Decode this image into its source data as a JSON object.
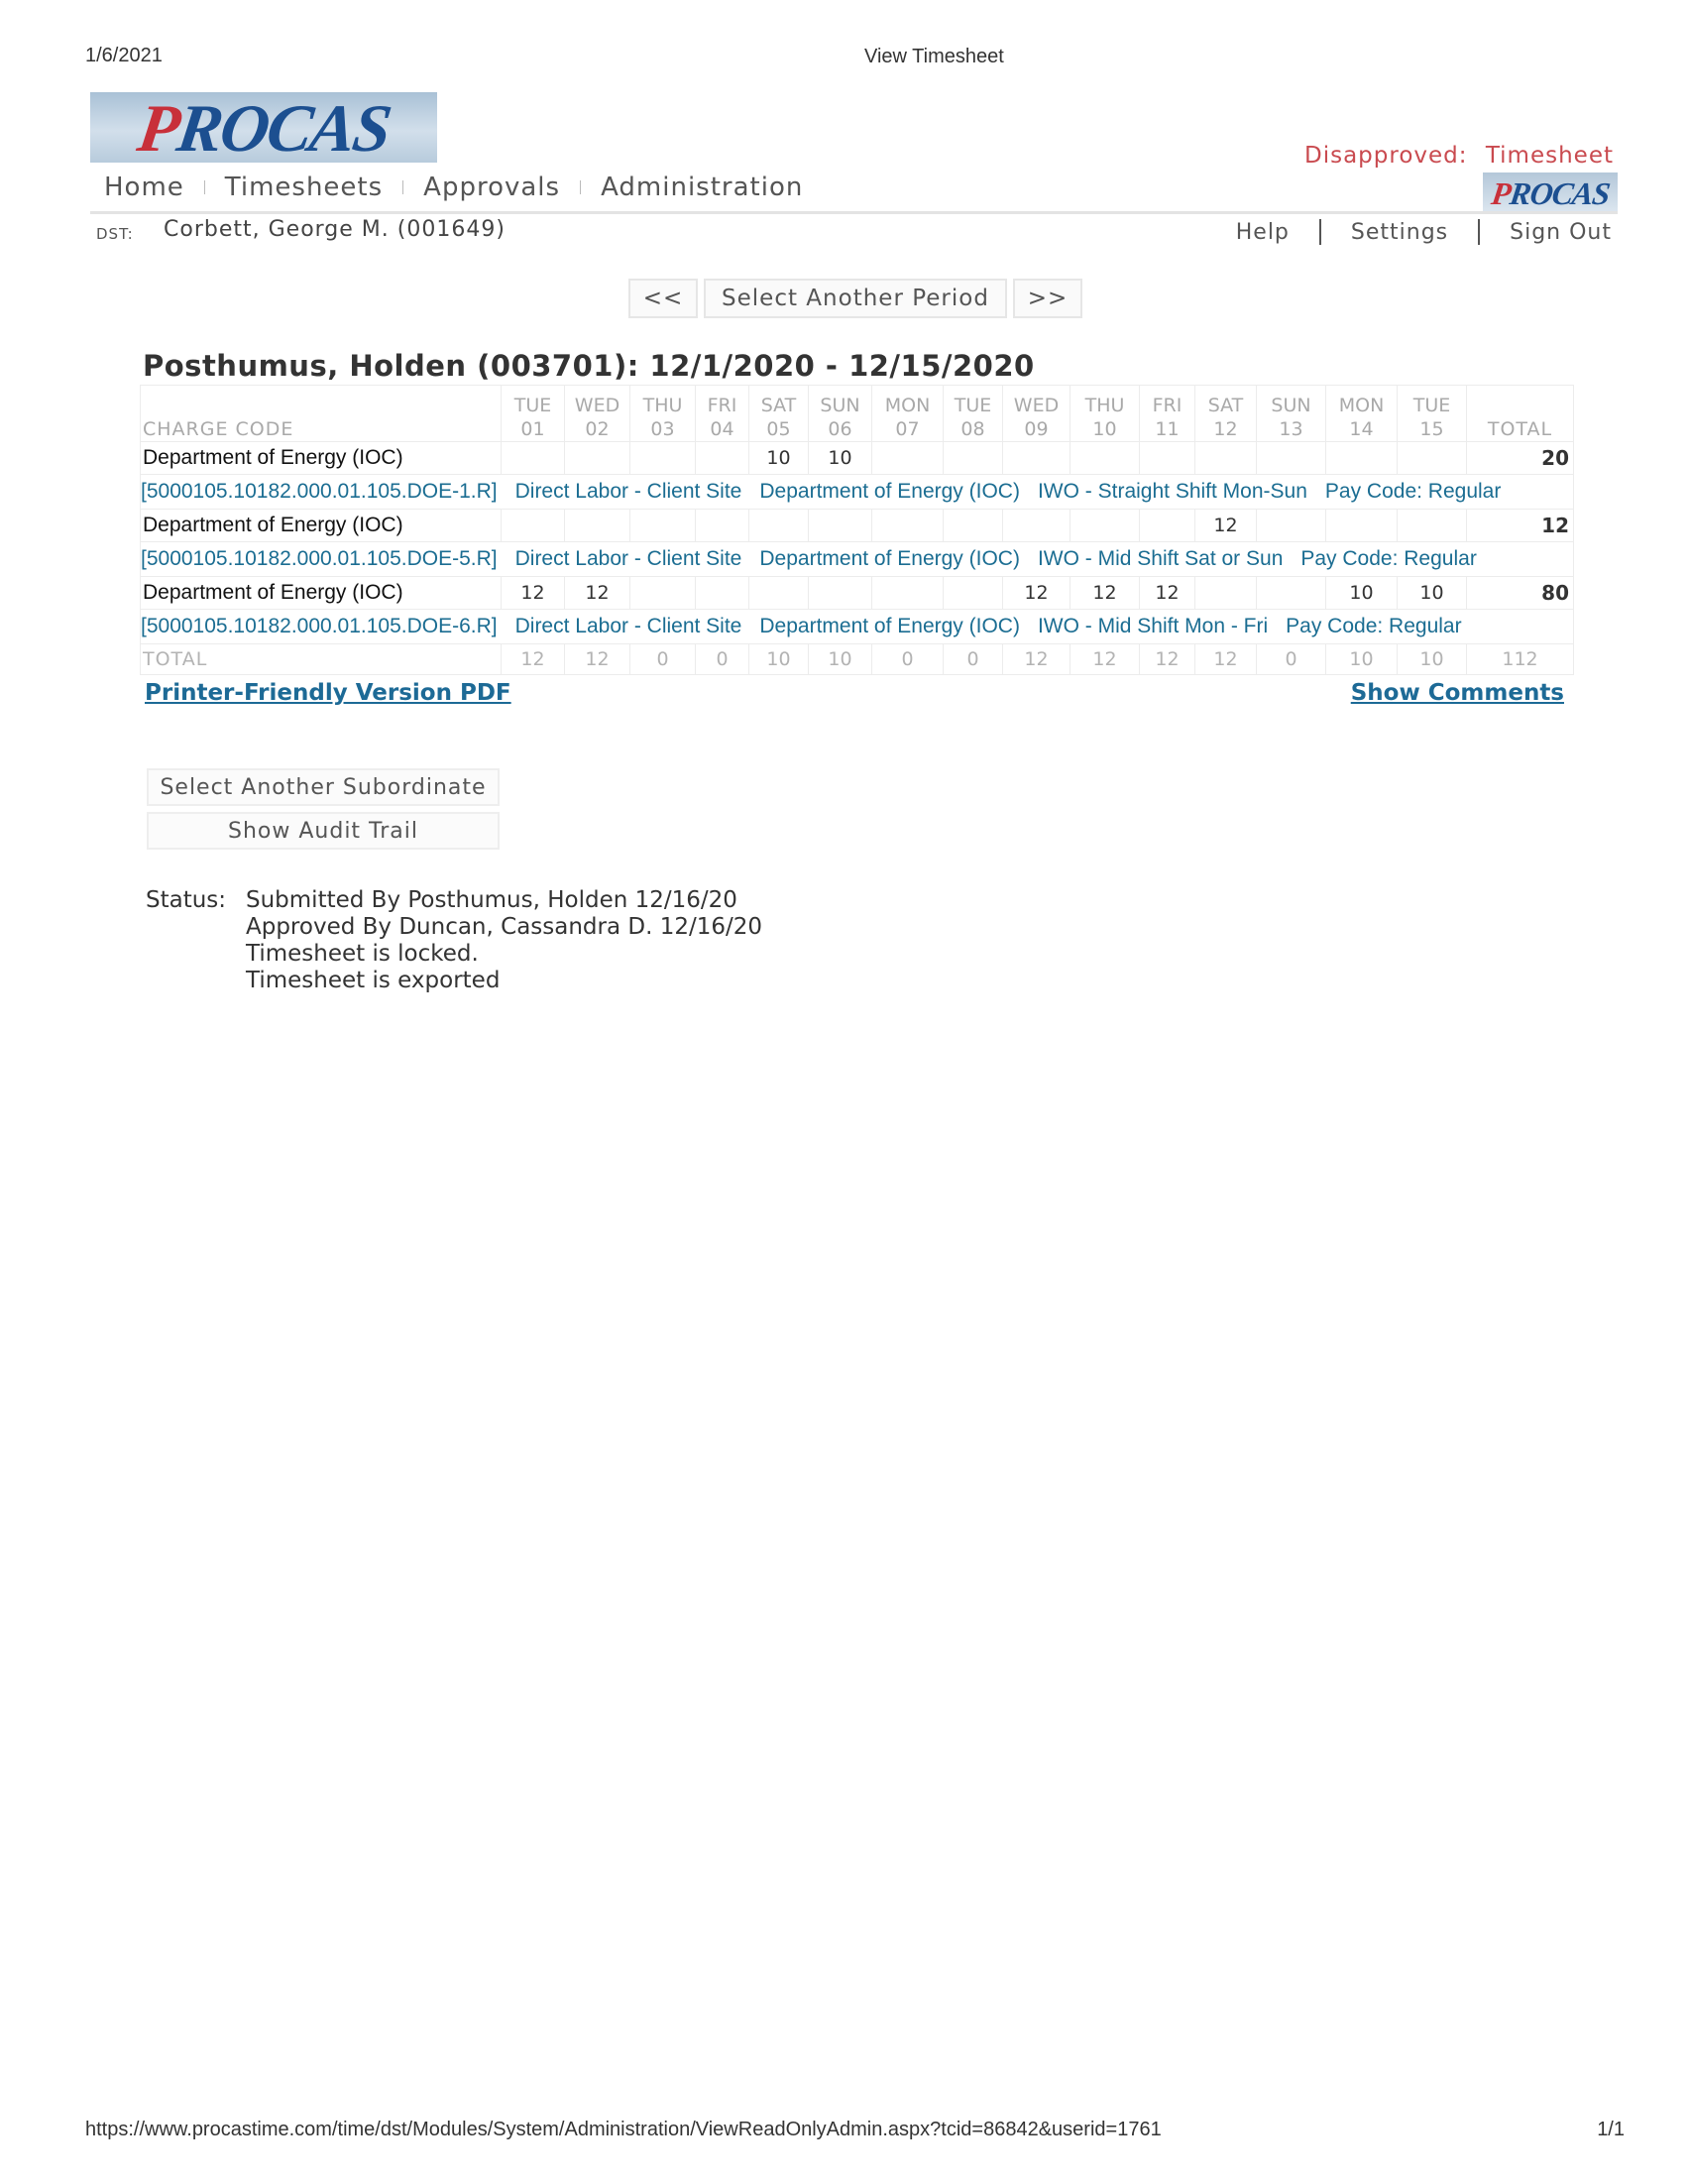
{
  "print_header": {
    "date": "1/6/2021",
    "title": "View Timesheet"
  },
  "logo": {
    "first": "P",
    "rest": "ROCAS"
  },
  "nav": {
    "home": "Home",
    "timesheets": "Timesheets",
    "approvals": "Approvals",
    "administration": "Administration"
  },
  "status_flag": {
    "label": "Disapproved:",
    "value": "Timesheet"
  },
  "dst": {
    "label": "DST:",
    "name": "Corbett, George M. (001649)"
  },
  "top_links": {
    "help": "Help",
    "settings": "Settings",
    "sign_out": "Sign Out"
  },
  "period": {
    "prev": "<<",
    "select": "Select Another Period",
    "next": ">>"
  },
  "sheet": {
    "title": "Posthumus, Holden (003701): 12/1/2020 - 12/15/2020",
    "charge_code_header": "CHARGE CODE",
    "total_header": "TOTAL",
    "days": [
      {
        "dow": "TUE",
        "day": "01"
      },
      {
        "dow": "WED",
        "day": "02"
      },
      {
        "dow": "THU",
        "day": "03"
      },
      {
        "dow": "FRI",
        "day": "04"
      },
      {
        "dow": "SAT",
        "day": "05"
      },
      {
        "dow": "SUN",
        "day": "06"
      },
      {
        "dow": "MON",
        "day": "07"
      },
      {
        "dow": "TUE",
        "day": "08"
      },
      {
        "dow": "WED",
        "day": "09"
      },
      {
        "dow": "THU",
        "day": "10"
      },
      {
        "dow": "FRI",
        "day": "11"
      },
      {
        "dow": "SAT",
        "day": "12"
      },
      {
        "dow": "SUN",
        "day": "13"
      },
      {
        "dow": "MON",
        "day": "14"
      },
      {
        "dow": "TUE",
        "day": "15"
      }
    ],
    "rows": [
      {
        "project": "Department of Energy (IOC)",
        "hours": [
          "",
          "",
          "",
          "",
          "10",
          "10",
          "",
          "",
          "",
          "",
          "",
          "",
          "",
          "",
          ""
        ],
        "total": "20",
        "code": "[5000105.10182.000.01.105.DOE-1.R]",
        "labor": "Direct Labor - Client Site",
        "client": "Department of Energy (IOC)",
        "shift": "IWO - Straight Shift Mon-Sun",
        "pay_code": "Pay Code: Regular"
      },
      {
        "project": "Department of Energy (IOC)",
        "hours": [
          "",
          "",
          "",
          "",
          "",
          "",
          "",
          "",
          "",
          "",
          "",
          "12",
          "",
          "",
          ""
        ],
        "total": "12",
        "code": "[5000105.10182.000.01.105.DOE-5.R]",
        "labor": "Direct Labor - Client Site",
        "client": "Department of Energy (IOC)",
        "shift": "IWO - Mid Shift Sat or Sun",
        "pay_code": "Pay Code: Regular"
      },
      {
        "project": "Department of Energy (IOC)",
        "hours": [
          "12",
          "12",
          "",
          "",
          "",
          "",
          "",
          "",
          "12",
          "12",
          "12",
          "",
          "",
          "10",
          "10"
        ],
        "total": "80",
        "code": "[5000105.10182.000.01.105.DOE-6.R]",
        "labor": "Direct Labor - Client Site",
        "client": "Department of Energy (IOC)",
        "shift": "IWO - Mid Shift Mon - Fri",
        "pay_code": "Pay Code: Regular"
      }
    ],
    "totals_label": "TOTAL",
    "totals": [
      "12",
      "12",
      "0",
      "0",
      "10",
      "10",
      "0",
      "0",
      "12",
      "12",
      "12",
      "12",
      "0",
      "10",
      "10"
    ],
    "grand_total": "112"
  },
  "links": {
    "printer_friendly": "Printer-Friendly Version PDF",
    "show_comments": "Show Comments"
  },
  "buttons": {
    "select_subordinate": "Select Another Subordinate",
    "audit_trail": "Show Audit Trail"
  },
  "status": {
    "label": "Status:",
    "lines": [
      "Submitted By Posthumus, Holden 12/16/20",
      "Approved By Duncan, Cassandra D. 12/16/20",
      "Timesheet is locked.",
      "Timesheet is exported"
    ]
  },
  "footer": {
    "url": "https://www.procastime.com/time/dst/Modules/System/Administration/ViewReadOnlyAdmin.aspx?tcid=86842&userid=1761",
    "page": "1/1"
  }
}
